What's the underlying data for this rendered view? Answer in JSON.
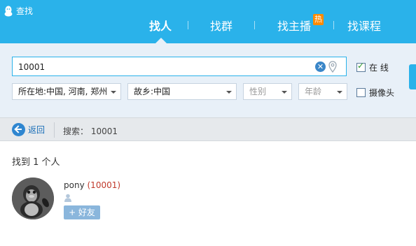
{
  "header": {
    "app_title": "查找",
    "tabs": [
      {
        "label": "找人",
        "active": true
      },
      {
        "label": "找群",
        "active": false
      },
      {
        "label": "找主播",
        "active": false,
        "badge": "热"
      },
      {
        "label": "找课程",
        "active": false
      }
    ]
  },
  "search": {
    "query": "10001",
    "online_label": "在 线",
    "online_checked": true,
    "camera_label": "摄像头",
    "camera_checked": false,
    "filters": {
      "location": "所在地:中国, 河南, 郑州",
      "hometown": "故乡:中国",
      "gender": "性别",
      "age": "年龄"
    }
  },
  "nav": {
    "back_label": "返回",
    "breadcrumb": "搜索： 10001"
  },
  "results": {
    "count_text": "找到 1 个人",
    "items": [
      {
        "name": "pony",
        "uid": "(10001)",
        "add_label": "+ 好友"
      }
    ]
  },
  "colors": {
    "header_bg": "#2ab2ea",
    "panel_bg": "#e8f0f8",
    "hot_badge": "#ff8a00",
    "uid_color": "#c0392b",
    "add_button": "#8ab6dc"
  },
  "icons": [
    "qq-penguin-icon",
    "clear-icon",
    "location-pin-icon",
    "back-arrow-icon",
    "gender-icon",
    "avatar-image"
  ]
}
